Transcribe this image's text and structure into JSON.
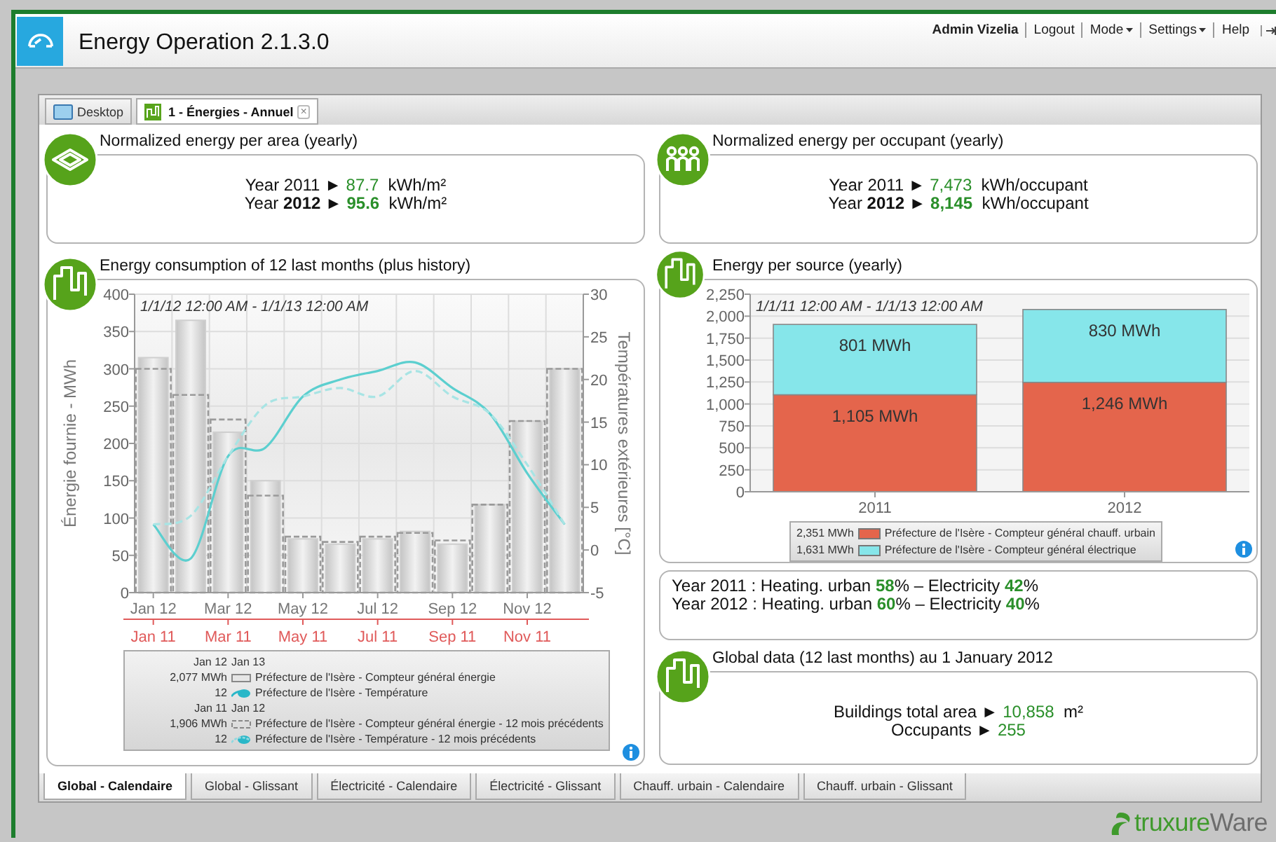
{
  "header": {
    "title": "Energy Operation 2.1.3.0",
    "menu": [
      {
        "label": "Admin Vizelia",
        "kind": "user"
      },
      {
        "label": "Logout",
        "kind": "link"
      },
      {
        "label": "Mode",
        "kind": "menu"
      },
      {
        "label": "Settings",
        "kind": "menu"
      },
      {
        "label": "Help",
        "kind": "link"
      }
    ]
  },
  "tabs": [
    {
      "label": "Desktop",
      "selected": false
    },
    {
      "label": "1 - Énergies - Annuel",
      "selected": true,
      "close": "×"
    }
  ],
  "area_card": {
    "title": "Normalized energy per area (yearly)",
    "lines": [
      {
        "label": "Year 2011",
        "arrow": "►",
        "value": "87.7",
        "unit": "kWh/m²",
        "emphasis": false
      },
      {
        "label": "Year **2012**",
        "arrow": "►",
        "value": "95.6",
        "unit": "kWh/m²",
        "emphasis": true
      }
    ]
  },
  "occupant_card": {
    "title": "Normalized energy per occupant (yearly)",
    "lines": [
      {
        "label": "Year 2011",
        "arrow": "►",
        "value": "7,473",
        "unit": "kWh/occupant",
        "emphasis": false
      },
      {
        "label": "Year **2012**",
        "arrow": "►",
        "value": "8,145",
        "unit": "kWh/occupant",
        "emphasis": true
      }
    ]
  },
  "consumption_card": {
    "title": "Energy consumption of 12 last months (plus history)",
    "range": "1/1/12 12:00 AM - 1/1/13 12:00 AM",
    "chart_data": {
      "type": "bar",
      "grid": true,
      "stacked": false,
      "ylabel": "Énergie fournie - MWh",
      "y2label": "Températures extérieures [°C]",
      "ylim": [
        0,
        400
      ],
      "y2lim": [
        -5,
        30
      ],
      "yticks": [
        0,
        50,
        100,
        150,
        200,
        250,
        300,
        350,
        400
      ],
      "y2ticks": [
        -5,
        0,
        5,
        10,
        15,
        20,
        25,
        30
      ],
      "categories": [
        "Jan 12",
        null,
        "Mar 12",
        null,
        "May 12",
        null,
        "Jul 12",
        null,
        "Sep 12",
        null,
        "Nov 12",
        null
      ],
      "series": [
        {
          "name": "Préfecture de l'Isère - Compteur général énergie",
          "line_style": "solid",
          "color": "#cfcfcf",
          "values": [
            315,
            365,
            215,
            150,
            72,
            65,
            72,
            82,
            65,
            118,
            230,
            300
          ]
        },
        {
          "name": "Préfecture de l'Isère - Température",
          "type": "line",
          "line_style": "solid",
          "axis": "y2",
          "color": "#5ccfcf",
          "values": [
            3,
            -1,
            11,
            12,
            18,
            20,
            21,
            22,
            19,
            16,
            9,
            3
          ]
        },
        {
          "name": "Préfecture de l'Isère - Compteur général énergie - 12 mois précédents",
          "line_style": "dashed",
          "color": "#9a9a9a",
          "values": [
            300,
            265,
            232,
            130,
            75,
            68,
            75,
            80,
            70,
            118,
            230,
            300
          ]
        },
        {
          "name": "Préfecture de l'Isère - Température - 12 mois précédents",
          "type": "line",
          "line_style": "dashed",
          "axis": "y2",
          "color": "#a8e4e4",
          "values": [
            3,
            4,
            11,
            17,
            18,
            19,
            18,
            21,
            18,
            16,
            10,
            3
          ]
        }
      ]
    },
    "history_axis": [
      "Jan 11",
      "Mar 11",
      "May 11",
      "Jul 11",
      "Sep 11",
      "Nov 11"
    ],
    "legend": [
      {
        "kind": "period",
        "from": "Jan 12",
        "to": "Jan 13"
      },
      {
        "kind": "series",
        "value": "2,077 MWh"
      },
      {
        "kind": "series",
        "value": "12"
      },
      {
        "kind": "period",
        "from": "Jan 11",
        "to": "Jan 12"
      },
      {
        "kind": "series",
        "value": "1,906 MWh"
      },
      {
        "kind": "series",
        "value": "12"
      }
    ]
  },
  "source_card": {
    "title": "Energy per source (yearly)",
    "range": "1/1/11 12:00 AM - 1/1/13 12:00 AM",
    "chart_data": {
      "type": "bar",
      "stacked": true,
      "grid": true,
      "categories": [
        "2011",
        "2012"
      ],
      "ylim": [
        0,
        2250
      ],
      "yticks": [
        {
          "value": 0,
          "label": "0"
        },
        {
          "value": 250,
          "label": "250"
        },
        {
          "value": 500,
          "label": "500"
        },
        {
          "value": 750,
          "label": "750"
        },
        {
          "value": 1000,
          "label": "1,000"
        },
        {
          "value": 1250,
          "label": "1,250"
        },
        {
          "value": 1500,
          "label": "1,500"
        },
        {
          "value": 1750,
          "label": "1,750"
        },
        {
          "value": 2000,
          "label": "2,000"
        },
        {
          "value": 2250,
          "label": "2,250"
        }
      ],
      "series": [
        {
          "name": "Préfecture de l'Isère - Compteur général chauff. urbain",
          "color": "#e4654c",
          "values": [
            1105,
            1246
          ]
        },
        {
          "name": "Préfecture de l'Isère - Compteur général électrique",
          "color": "#86e6ea",
          "values": [
            801,
            830
          ]
        }
      ],
      "value_labels": [
        [
          "1,105 MWh",
          "1,246 MWh"
        ],
        [
          "801 MWh",
          "830 MWh"
        ]
      ]
    },
    "legend": [
      {
        "value": "2,351 MWh"
      },
      {
        "value": "1,631 MWh"
      }
    ]
  },
  "share_card": {
    "lines": [
      "Year 2011 : Heating. urban **58**% – Electricity **42**%",
      "Year 2012 : Heating. urban **60**% – Electricity **40**%"
    ]
  },
  "global_card": {
    "title": "Global data (12 last months) au 1 January 2012",
    "lines": [
      {
        "label": "Buildings total area",
        "arrow": "►",
        "value": "10,858",
        "unit": "m²",
        "emphasis": false
      },
      {
        "label": "Occupants",
        "arrow": "►",
        "value": "255",
        "emphasis": false
      }
    ]
  },
  "bottom_tabs": [
    {
      "label": "Global - Calendaire",
      "selected": true
    },
    {
      "label": "Global - Glissant",
      "selected": false
    },
    {
      "label": "Électricité - Calendaire",
      "selected": false
    },
    {
      "label": "Électricité - Glissant",
      "selected": false
    },
    {
      "label": "Chauff. urbain - Calendaire",
      "selected": false
    },
    {
      "label": "Chauff. urbain - Glissant",
      "selected": false
    }
  ],
  "brand": {
    "prefix": "truxure",
    "suffix": "Ware"
  }
}
